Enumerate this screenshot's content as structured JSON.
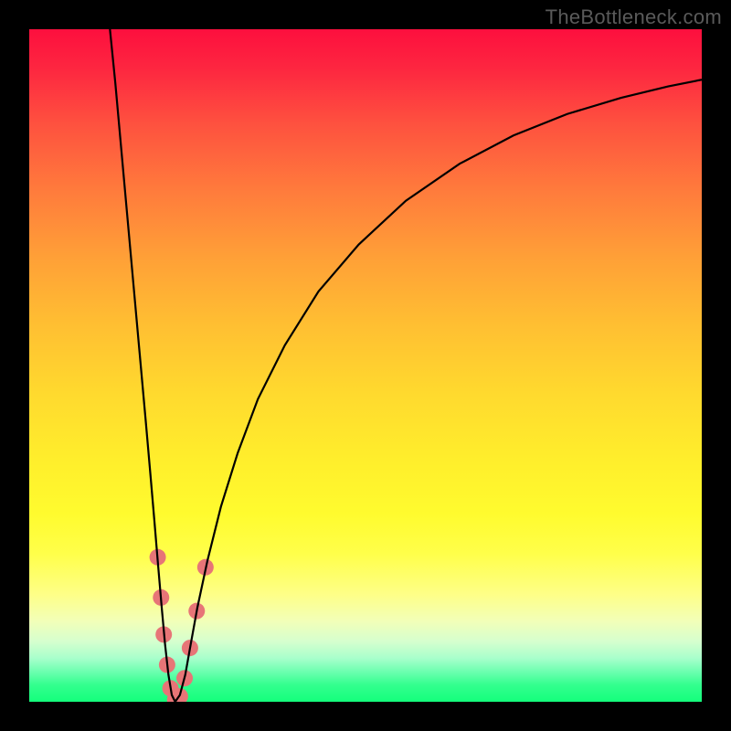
{
  "watermark": "TheBottleneck.com",
  "colors": {
    "frame": "#000000",
    "curve": "#000000",
    "marker": "#e77577",
    "gradient_top": "#fd0f3e",
    "gradient_bottom": "#14ff7c"
  },
  "chart_data": {
    "type": "line",
    "title": "",
    "xlabel": "",
    "ylabel": "",
    "xlim": [
      0,
      100
    ],
    "ylim": [
      0,
      100
    ],
    "grid": false,
    "legend": false,
    "curve_points": [
      {
        "x": 12.0,
        "y": 100.0
      },
      {
        "x": 12.8,
        "y": 92.0
      },
      {
        "x": 13.7,
        "y": 82.0
      },
      {
        "x": 14.6,
        "y": 72.0
      },
      {
        "x": 15.5,
        "y": 62.0
      },
      {
        "x": 16.4,
        "y": 52.0
      },
      {
        "x": 17.3,
        "y": 42.0
      },
      {
        "x": 18.0,
        "y": 34.0
      },
      {
        "x": 18.6,
        "y": 27.0
      },
      {
        "x": 19.1,
        "y": 21.0
      },
      {
        "x": 19.7,
        "y": 14.0
      },
      {
        "x": 20.2,
        "y": 8.5
      },
      {
        "x": 20.7,
        "y": 4.0
      },
      {
        "x": 21.2,
        "y": 1.0
      },
      {
        "x": 21.7,
        "y": 0.0
      },
      {
        "x": 22.4,
        "y": 1.0
      },
      {
        "x": 23.2,
        "y": 4.0
      },
      {
        "x": 24.0,
        "y": 8.5
      },
      {
        "x": 25.0,
        "y": 14.0
      },
      {
        "x": 26.5,
        "y": 21.0
      },
      {
        "x": 28.5,
        "y": 29.0
      },
      {
        "x": 31.0,
        "y": 37.0
      },
      {
        "x": 34.0,
        "y": 45.0
      },
      {
        "x": 38.0,
        "y": 53.0
      },
      {
        "x": 43.0,
        "y": 61.0
      },
      {
        "x": 49.0,
        "y": 68.0
      },
      {
        "x": 56.0,
        "y": 74.5
      },
      {
        "x": 64.0,
        "y": 80.0
      },
      {
        "x": 72.0,
        "y": 84.2
      },
      {
        "x": 80.0,
        "y": 87.4
      },
      {
        "x": 88.0,
        "y": 89.8
      },
      {
        "x": 95.0,
        "y": 91.5
      },
      {
        "x": 100.0,
        "y": 92.5
      }
    ],
    "minimum": {
      "x": 21.7,
      "y": 0.0
    },
    "markers": [
      {
        "x": 19.1,
        "y": 21.5
      },
      {
        "x": 19.6,
        "y": 15.5
      },
      {
        "x": 20.0,
        "y": 10.0
      },
      {
        "x": 20.5,
        "y": 5.5
      },
      {
        "x": 21.0,
        "y": 2.0
      },
      {
        "x": 21.7,
        "y": 0.3
      },
      {
        "x": 22.4,
        "y": 0.8
      },
      {
        "x": 23.1,
        "y": 3.5
      },
      {
        "x": 23.9,
        "y": 8.0
      },
      {
        "x": 24.9,
        "y": 13.5
      },
      {
        "x": 26.2,
        "y": 20.0
      }
    ]
  }
}
